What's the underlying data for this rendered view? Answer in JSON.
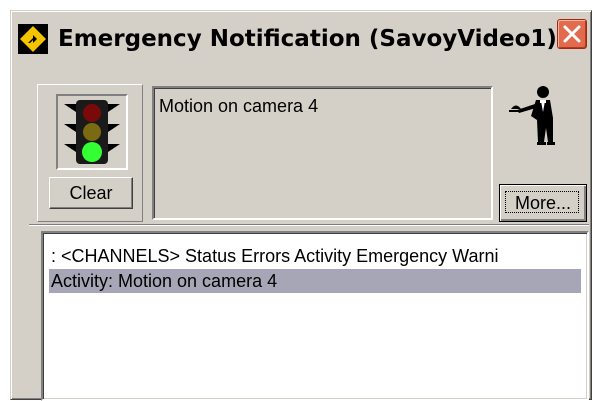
{
  "window": {
    "title": "Emergency Notification (SavoyVideo1)",
    "close_icon": "close-x-icon"
  },
  "signal": {
    "icon": "traffic-light-icon",
    "active_light": "green",
    "clear_label": "Clear"
  },
  "message": {
    "text": "Motion on camera 4"
  },
  "assistant": {
    "icon": "butler-icon",
    "more_label": "More..."
  },
  "log": {
    "header": ": <CHANNELS> Status Errors Activity Emergency Warni",
    "rows": [
      {
        "text": "Activity: Motion on camera 4",
        "selected": true
      }
    ]
  },
  "colors": {
    "face": "#d4d0c8",
    "close_button": "#e26a4d",
    "selection": "#a6a6b6",
    "light_on_green": "#33ff33"
  }
}
